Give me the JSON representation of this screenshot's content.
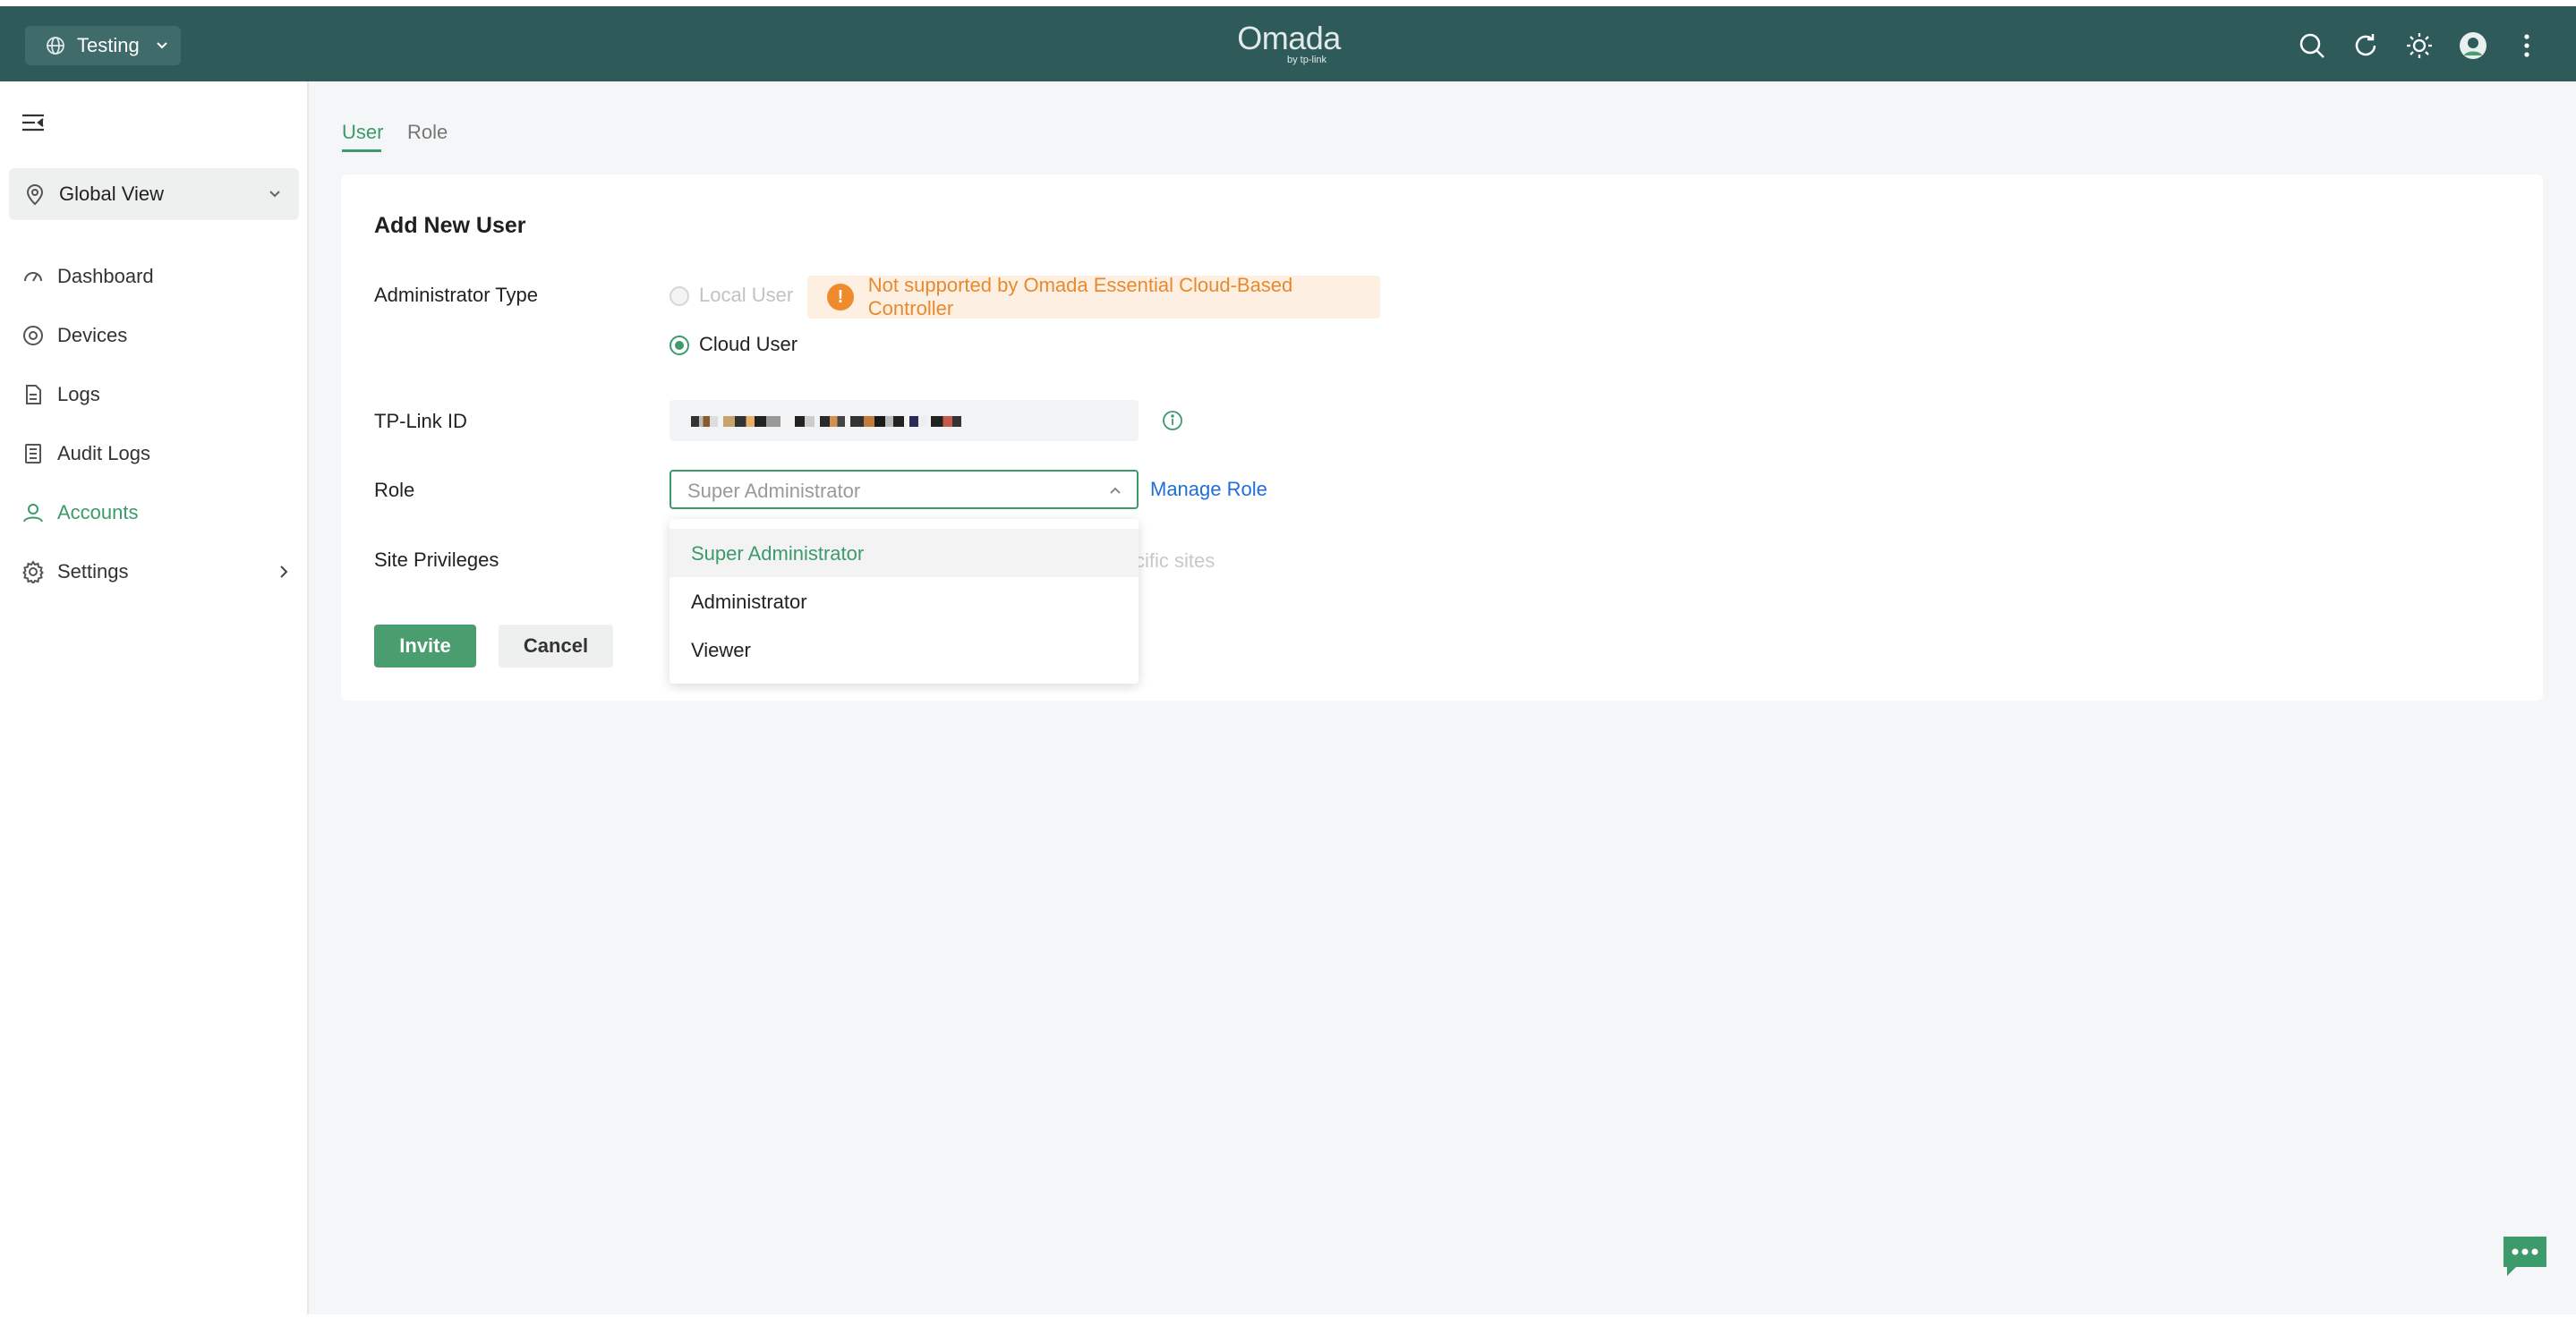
{
  "topbar": {
    "site_selector": "Testing",
    "logo": {
      "brand": "Omada",
      "sub": "by tp-link"
    },
    "icons": [
      "search-icon",
      "refresh-icon",
      "theme-icon",
      "avatar",
      "more-icon"
    ]
  },
  "sidebar": {
    "global_view": "Global View",
    "items": [
      {
        "label": "Dashboard",
        "icon": "dashboard-icon"
      },
      {
        "label": "Devices",
        "icon": "devices-icon"
      },
      {
        "label": "Logs",
        "icon": "logs-icon"
      },
      {
        "label": "Audit Logs",
        "icon": "audit-logs-icon"
      },
      {
        "label": "Accounts",
        "icon": "accounts-icon",
        "active": true
      },
      {
        "label": "Settings",
        "icon": "settings-icon"
      }
    ]
  },
  "tabs": [
    {
      "label": "User",
      "active": true
    },
    {
      "label": "Role",
      "active": false
    }
  ],
  "form": {
    "title": "Add New User",
    "admin_type": {
      "label": "Administrator Type",
      "options": [
        {
          "label": "Local User",
          "disabled": true,
          "checked": false
        },
        {
          "label": "Cloud User",
          "disabled": false,
          "checked": true
        }
      ],
      "warning": "Not supported by Omada Essential Cloud-Based Controller"
    },
    "tplink_id": {
      "label": "TP-Link ID"
    },
    "role": {
      "label": "Role",
      "placeholder": "Super Administrator",
      "manage_link": "Manage Role",
      "options": [
        "Super Administrator",
        "Administrator",
        "Viewer"
      ],
      "selected": "Super Administrator"
    },
    "site_privileges": {
      "label": "Site Privileges",
      "obscured_text": "cific sites"
    },
    "buttons": {
      "invite": "Invite",
      "cancel": "Cancel"
    }
  },
  "colors": {
    "topbar": "#2e5b5a",
    "accent": "#3d9a6b",
    "warning": "#e8892d",
    "link": "#1f6fd6"
  }
}
